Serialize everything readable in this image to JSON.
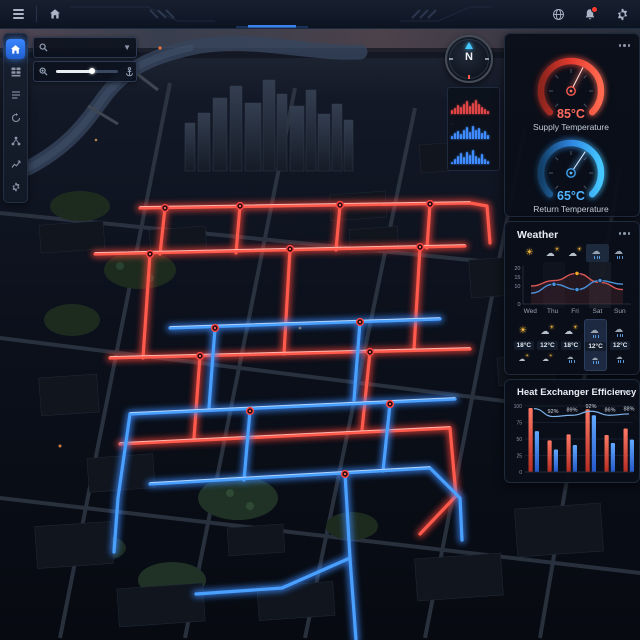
{
  "theme": {
    "supply_color": "#ff4438",
    "return_color": "#3a8bff",
    "accent": "#3f8cff",
    "panel_bg": "#0a0f19",
    "warn_red": "#ff3b30"
  },
  "topbar": {
    "icons": [
      {
        "name": "hamburger-menu-icon"
      },
      {
        "name": "home-icon"
      },
      {
        "name": "globe-icon"
      },
      {
        "name": "bell-icon",
        "has_alert": true
      },
      {
        "name": "gear-icon"
      }
    ]
  },
  "sidebar": {
    "items": [
      {
        "icon": "home",
        "active": true
      },
      {
        "icon": "modules",
        "active": false
      },
      {
        "icon": "layers",
        "active": false
      },
      {
        "icon": "sync",
        "active": false
      },
      {
        "icon": "network",
        "active": false
      },
      {
        "icon": "analytics",
        "active": false
      },
      {
        "icon": "settings",
        "active": false
      }
    ]
  },
  "map_controls": {
    "search": {
      "placeholder": "",
      "value": ""
    },
    "zoom_slider": {
      "value_pct": 58
    },
    "compass": {
      "label": "N"
    }
  },
  "mini_charts": {
    "rows": [
      {
        "name": "supply-activity",
        "color": "#e04545",
        "values": [
          4,
          6,
          9,
          7,
          10,
          13,
          8,
          11,
          14,
          10,
          7,
          5,
          3
        ]
      },
      {
        "name": "return-activity-1",
        "color": "#3f8cff",
        "values": [
          3,
          6,
          8,
          5,
          9,
          12,
          7,
          13,
          9,
          11,
          6,
          8,
          4
        ]
      },
      {
        "name": "return-activity-2",
        "color": "#3f8cff",
        "values": [
          2,
          5,
          8,
          11,
          7,
          12,
          9,
          14,
          8,
          6,
          10,
          5,
          3
        ]
      }
    ]
  },
  "panels": {
    "gauges": {
      "supply": {
        "value": "85°C",
        "label": "Supply Temperature"
      },
      "return": {
        "value": "65°C",
        "label": "Return Temperature"
      }
    },
    "weather": {
      "title": "Weather",
      "icons_row": [
        "sunny",
        "partly",
        "partly",
        "rain",
        "rain"
      ],
      "highlight_index": 3,
      "forecast": [
        {
          "day": "Wed",
          "icon": "sunny",
          "temp": "18°C",
          "sub_icon": "partly"
        },
        {
          "day": "Thu",
          "icon": "partly",
          "temp": "12°C",
          "sub_icon": "partly"
        },
        {
          "day": "Fri",
          "icon": "partly",
          "temp": "18°C",
          "sub_icon": "rain"
        },
        {
          "day": "Sat",
          "icon": "rain",
          "temp": "12°C",
          "sub_icon": "rain"
        },
        {
          "day": "Sun",
          "icon": "rain",
          "temp": "12°C",
          "sub_icon": "rain"
        }
      ]
    },
    "efficiency": {
      "title": "Heat Exchanger Efficiency"
    }
  },
  "chart_data": [
    {
      "type": "line",
      "title": "Weather",
      "categories": [
        "Wed",
        "Thu",
        "Fri",
        "Sat",
        "Sun"
      ],
      "series": [
        {
          "name": "supply-trend",
          "color": "#d95757",
          "values": [
            10,
            13,
            17,
            12,
            8
          ],
          "markers": [
            {
              "index": 2,
              "color": "#f5a623"
            }
          ]
        },
        {
          "name": "return-trend",
          "color": "#4a90d9",
          "values": [
            6,
            11,
            8,
            13,
            11
          ],
          "markers": [
            {
              "index": 1,
              "color": "#4a90d9"
            },
            {
              "index": 2,
              "color": "#4a90d9"
            },
            {
              "index": 3,
              "color": "#4a90d9"
            }
          ]
        }
      ],
      "ylim": [
        0,
        20
      ],
      "yticks": [
        20,
        15,
        10,
        0
      ],
      "grid": false,
      "legend": "none"
    },
    {
      "type": "bar",
      "title": "Heat Exchanger Efficiency",
      "categories": [
        "",
        "",
        "",
        "",
        "",
        ""
      ],
      "series": [
        {
          "name": "supply",
          "color": "#ff5a4e",
          "values": [
            97,
            48,
            57,
            95,
            56,
            66
          ]
        },
        {
          "name": "return",
          "color": "#3f8cff",
          "values": [
            62,
            34,
            41,
            86,
            44,
            49
          ]
        }
      ],
      "line_overlay": {
        "name": "efficiency",
        "color": "#7fb3e8",
        "values": [
          96,
          84,
          86,
          92,
          86,
          88
        ],
        "labels": [
          "",
          "92%",
          "89%",
          "92%",
          "86%",
          "88%"
        ]
      },
      "ylim": [
        0,
        100
      ],
      "yticks": [
        100,
        75,
        50,
        25,
        0
      ],
      "grid": true,
      "legend": "none"
    }
  ]
}
